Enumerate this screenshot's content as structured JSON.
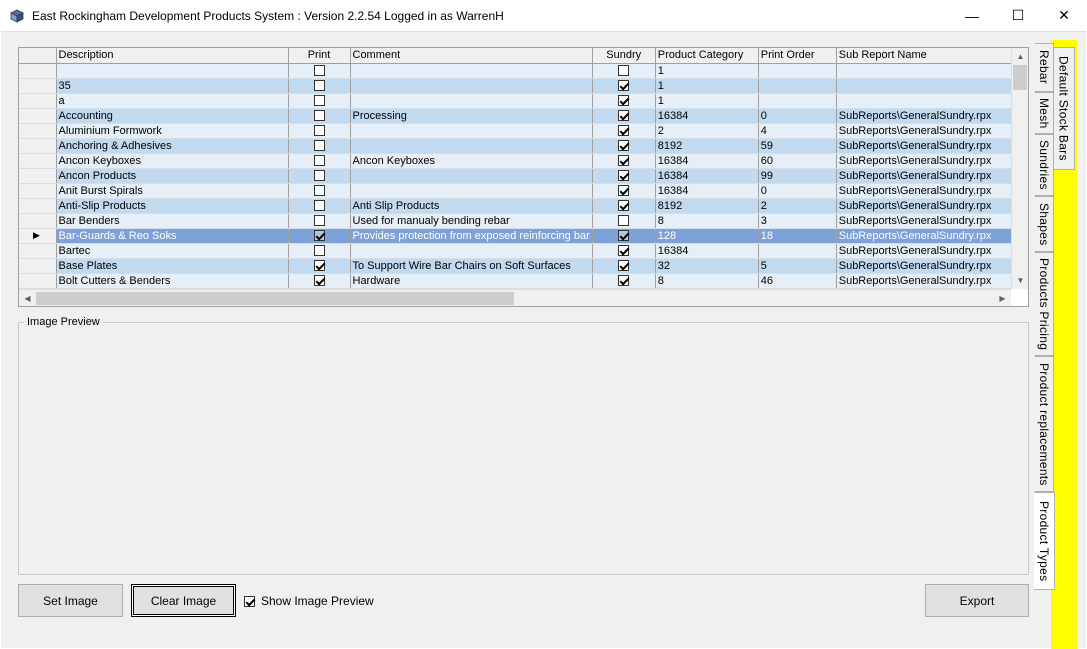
{
  "window": {
    "title": "East Rockingham Development Products System : Version 2.2.54 Logged in as WarrenH",
    "minimize_glyph": "—",
    "maximize_glyph": "☐",
    "close_glyph": "✕"
  },
  "grid": {
    "columns": [
      "Description",
      "Print",
      "Comment",
      "Sundry",
      "Product Category",
      "Print Order",
      "Sub Report Name"
    ],
    "rows": [
      {
        "description": "",
        "print": false,
        "comment": "",
        "sundry": false,
        "category": "1",
        "order": "",
        "subreport": "",
        "selected": false
      },
      {
        "description": "35",
        "print": false,
        "comment": "",
        "sundry": true,
        "category": "1",
        "order": "",
        "subreport": "",
        "selected": false
      },
      {
        "description": "a",
        "print": false,
        "comment": "",
        "sundry": true,
        "category": "1",
        "order": "",
        "subreport": "",
        "selected": false
      },
      {
        "description": "Accounting",
        "print": false,
        "comment": "Processing",
        "sundry": true,
        "category": "16384",
        "order": "0",
        "subreport": "SubReports\\GeneralSundry.rpx",
        "selected": false
      },
      {
        "description": "Aluminium Formwork",
        "print": false,
        "comment": "",
        "sundry": true,
        "category": "2",
        "order": "4",
        "subreport": "SubReports\\GeneralSundry.rpx",
        "selected": false
      },
      {
        "description": "Anchoring & Adhesives",
        "print": false,
        "comment": "",
        "sundry": true,
        "category": "8192",
        "order": "59",
        "subreport": "SubReports\\GeneralSundry.rpx",
        "selected": false
      },
      {
        "description": "Ancon Keyboxes",
        "print": false,
        "comment": "Ancon Keyboxes",
        "sundry": true,
        "category": "16384",
        "order": "60",
        "subreport": "SubReports\\GeneralSundry.rpx",
        "selected": false
      },
      {
        "description": "Ancon Products",
        "print": false,
        "comment": "",
        "sundry": true,
        "category": "16384",
        "order": "99",
        "subreport": "SubReports\\GeneralSundry.rpx",
        "selected": false
      },
      {
        "description": "Anit Burst Spirals",
        "print": false,
        "comment": "",
        "sundry": true,
        "category": "16384",
        "order": "0",
        "subreport": "SubReports\\GeneralSundry.rpx",
        "selected": false
      },
      {
        "description": "Anti-Slip Products",
        "print": false,
        "comment": "Anti Slip Products",
        "sundry": true,
        "category": "8192",
        "order": "2",
        "subreport": "SubReports\\GeneralSundry.rpx",
        "selected": false
      },
      {
        "description": "Bar Benders",
        "print": false,
        "comment": "Used for manualy bending rebar",
        "sundry": false,
        "category": "8",
        "order": "3",
        "subreport": "SubReports\\GeneralSundry.rpx",
        "selected": false
      },
      {
        "description": "Bar-Guards & Reo Soks",
        "print": true,
        "comment": "Provides protection from exposed reinforcing bar",
        "sundry": true,
        "category": "128",
        "order": "18",
        "subreport": "SubReports\\GeneralSundry.rpx",
        "selected": true
      },
      {
        "description": "Bartec",
        "print": false,
        "comment": "",
        "sundry": true,
        "category": "16384",
        "order": "",
        "subreport": "SubReports\\GeneralSundry.rpx",
        "selected": false
      },
      {
        "description": "Base Plates",
        "print": true,
        "comment": "To Support Wire Bar Chairs on Soft Surfaces",
        "sundry": true,
        "category": "32",
        "order": "5",
        "subreport": "SubReports\\GeneralSundry.rpx",
        "selected": false
      },
      {
        "description": "Bolt Cutters & Benders",
        "print": true,
        "comment": "Hardware",
        "sundry": true,
        "category": "8",
        "order": "46",
        "subreport": "SubReports\\GeneralSundry.rpx",
        "selected": false
      }
    ],
    "current_row_indicator": "▶"
  },
  "preview": {
    "legend": "Image Preview"
  },
  "buttons": {
    "set_image": "Set Image",
    "clear_image": "Clear Image",
    "export": "Export"
  },
  "show_preview": {
    "label": "Show Image Preview",
    "checked": true
  },
  "tabs": [
    {
      "label": "Default Stock Bars",
      "active": false
    },
    {
      "label": "Rebar",
      "active": false
    },
    {
      "label": "Mesh",
      "active": false
    },
    {
      "label": "Sundries",
      "active": false
    },
    {
      "label": "Shapes",
      "active": false
    },
    {
      "label": "Products Pricing",
      "active": false
    },
    {
      "label": "Product replacements",
      "active": false
    },
    {
      "label": "Product Types",
      "active": true
    }
  ],
  "colors": {
    "highlight_yellow": "#ffff00",
    "row_odd": "#e6eef8",
    "row_even": "#c2daf0",
    "row_selected": "#7ea1d8"
  }
}
